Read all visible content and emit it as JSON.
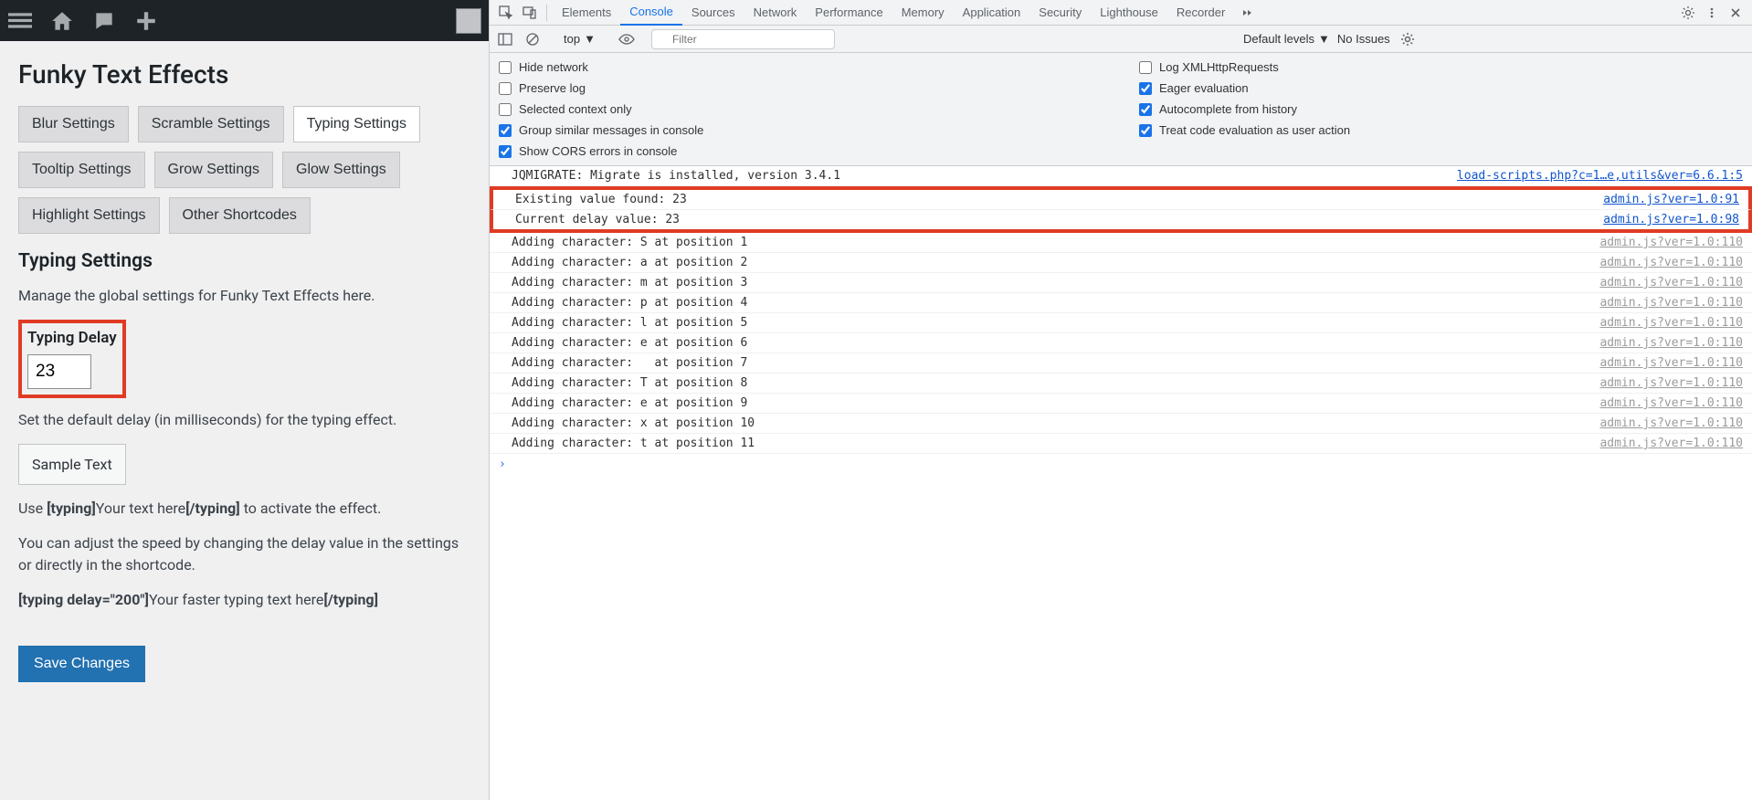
{
  "wp": {
    "title": "Funky Text Effects",
    "tabs": [
      "Blur Settings",
      "Scramble Settings",
      "Typing Settings",
      "Tooltip Settings",
      "Grow Settings",
      "Glow Settings",
      "Highlight Settings",
      "Other Shortcodes"
    ],
    "active_tab": "Typing Settings",
    "section_title": "Typing Settings",
    "intro": "Manage the global settings for Funky Text Effects here.",
    "field_label": "Typing Delay",
    "field_value": "23",
    "field_help": "Set the default delay (in milliseconds) for the typing effect.",
    "sample": "Sample Text",
    "usage_pre": "Use ",
    "usage_open": "[typing]",
    "usage_mid": "Your text here",
    "usage_close": "[/typing]",
    "usage_post": " to activate the effect.",
    "adjust": "You can adjust the speed by changing the delay value in the settings or directly in the shortcode.",
    "example_open": "[typing delay=\"200\"]",
    "example_mid": "Your faster typing text here",
    "example_close": "[/typing]",
    "save": "Save Changes"
  },
  "dt": {
    "tabs": [
      "Elements",
      "Console",
      "Sources",
      "Network",
      "Performance",
      "Memory",
      "Application",
      "Security",
      "Lighthouse",
      "Recorder"
    ],
    "active": "Console",
    "context": "top",
    "filter_placeholder": "Filter",
    "levels": "Default levels",
    "issues": "No Issues",
    "settings": {
      "left": [
        {
          "label": "Hide network",
          "checked": false
        },
        {
          "label": "Preserve log",
          "checked": false
        },
        {
          "label": "Selected context only",
          "checked": false
        },
        {
          "label": "Group similar messages in console",
          "checked": true
        },
        {
          "label": "Show CORS errors in console",
          "checked": true
        }
      ],
      "right": [
        {
          "label": "Log XMLHttpRequests",
          "checked": false
        },
        {
          "label": "Eager evaluation",
          "checked": true
        },
        {
          "label": "Autocomplete from history",
          "checked": true
        },
        {
          "label": "Treat code evaluation as user action",
          "checked": true
        }
      ]
    },
    "logs": [
      {
        "msg": "JQMIGRATE: Migrate is installed, version 3.4.1",
        "src": "load-scripts.php?c=1…e,utils&ver=6.6.1:5",
        "hl": false
      },
      {
        "msg": "Existing value found: 23",
        "src": "admin.js?ver=1.0:91",
        "hl": true
      },
      {
        "msg": "Current delay value: 23",
        "src": "admin.js?ver=1.0:98",
        "hl": true
      },
      {
        "msg": "Adding character: S at position 1",
        "src": "admin.js?ver=1.0:110",
        "hl": false
      },
      {
        "msg": "Adding character: a at position 2",
        "src": "admin.js?ver=1.0:110",
        "hl": false
      },
      {
        "msg": "Adding character: m at position 3",
        "src": "admin.js?ver=1.0:110",
        "hl": false
      },
      {
        "msg": "Adding character: p at position 4",
        "src": "admin.js?ver=1.0:110",
        "hl": false
      },
      {
        "msg": "Adding character: l at position 5",
        "src": "admin.js?ver=1.0:110",
        "hl": false
      },
      {
        "msg": "Adding character: e at position 6",
        "src": "admin.js?ver=1.0:110",
        "hl": false
      },
      {
        "msg": "Adding character:   at position 7",
        "src": "admin.js?ver=1.0:110",
        "hl": false
      },
      {
        "msg": "Adding character: T at position 8",
        "src": "admin.js?ver=1.0:110",
        "hl": false
      },
      {
        "msg": "Adding character: e at position 9",
        "src": "admin.js?ver=1.0:110",
        "hl": false
      },
      {
        "msg": "Adding character: x at position 10",
        "src": "admin.js?ver=1.0:110",
        "hl": false
      },
      {
        "msg": "Adding character: t at position 11",
        "src": "admin.js?ver=1.0:110",
        "hl": false
      }
    ]
  }
}
